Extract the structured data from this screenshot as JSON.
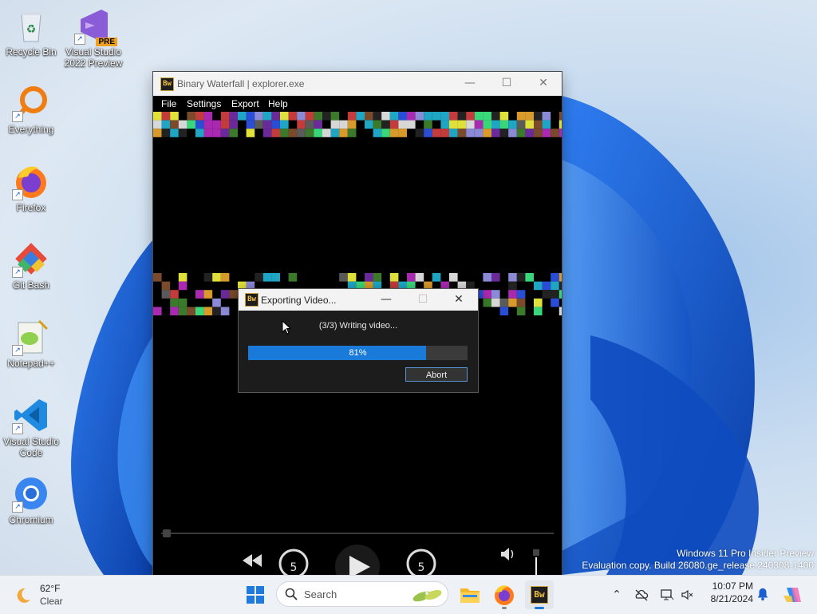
{
  "desktop": {
    "icons": [
      {
        "label1": "Recycle Bin",
        "label2": ""
      },
      {
        "label1": "Visual Studio",
        "label2": "2022 Preview",
        "badge": "PRE"
      },
      {
        "label1": "Everything",
        "label2": ""
      },
      {
        "label1": "Firefox",
        "label2": ""
      },
      {
        "label1": "Git Bash",
        "label2": ""
      },
      {
        "label1": "Notepad++",
        "label2": ""
      },
      {
        "label1": "Visual Studio",
        "label2": "Code"
      },
      {
        "label1": "Chromium",
        "label2": ""
      }
    ]
  },
  "main_window": {
    "title": "Binary Waterfall | explorer.exe",
    "icon_text": "Bw",
    "controls": {
      "minimize": "—",
      "maximize": "☐",
      "close": "✕"
    },
    "menu": [
      "File",
      "Settings",
      "Export",
      "Help"
    ],
    "skip_back_label": "5",
    "skip_forward_label": "5"
  },
  "export_dialog": {
    "title": "Exporting Video...",
    "icon_text": "Bw",
    "status": "(3/3) Writing video...",
    "progress": 0.81,
    "progress_label": "81%",
    "abort_label": "Abort"
  },
  "watermark": {
    "line1": "Windows 11 Pro Insider Preview",
    "line2": "Evaluation copy. Build 26080.ge_release.240308-1400"
  },
  "taskbar": {
    "weather_temp": "62°F",
    "weather_desc": "Clear",
    "search_placeholder": "Search",
    "time": "10:07 PM",
    "date": "8/21/2024"
  },
  "colors": {
    "accent": "#1a7ad9",
    "abort_border": "#5a94d3"
  }
}
